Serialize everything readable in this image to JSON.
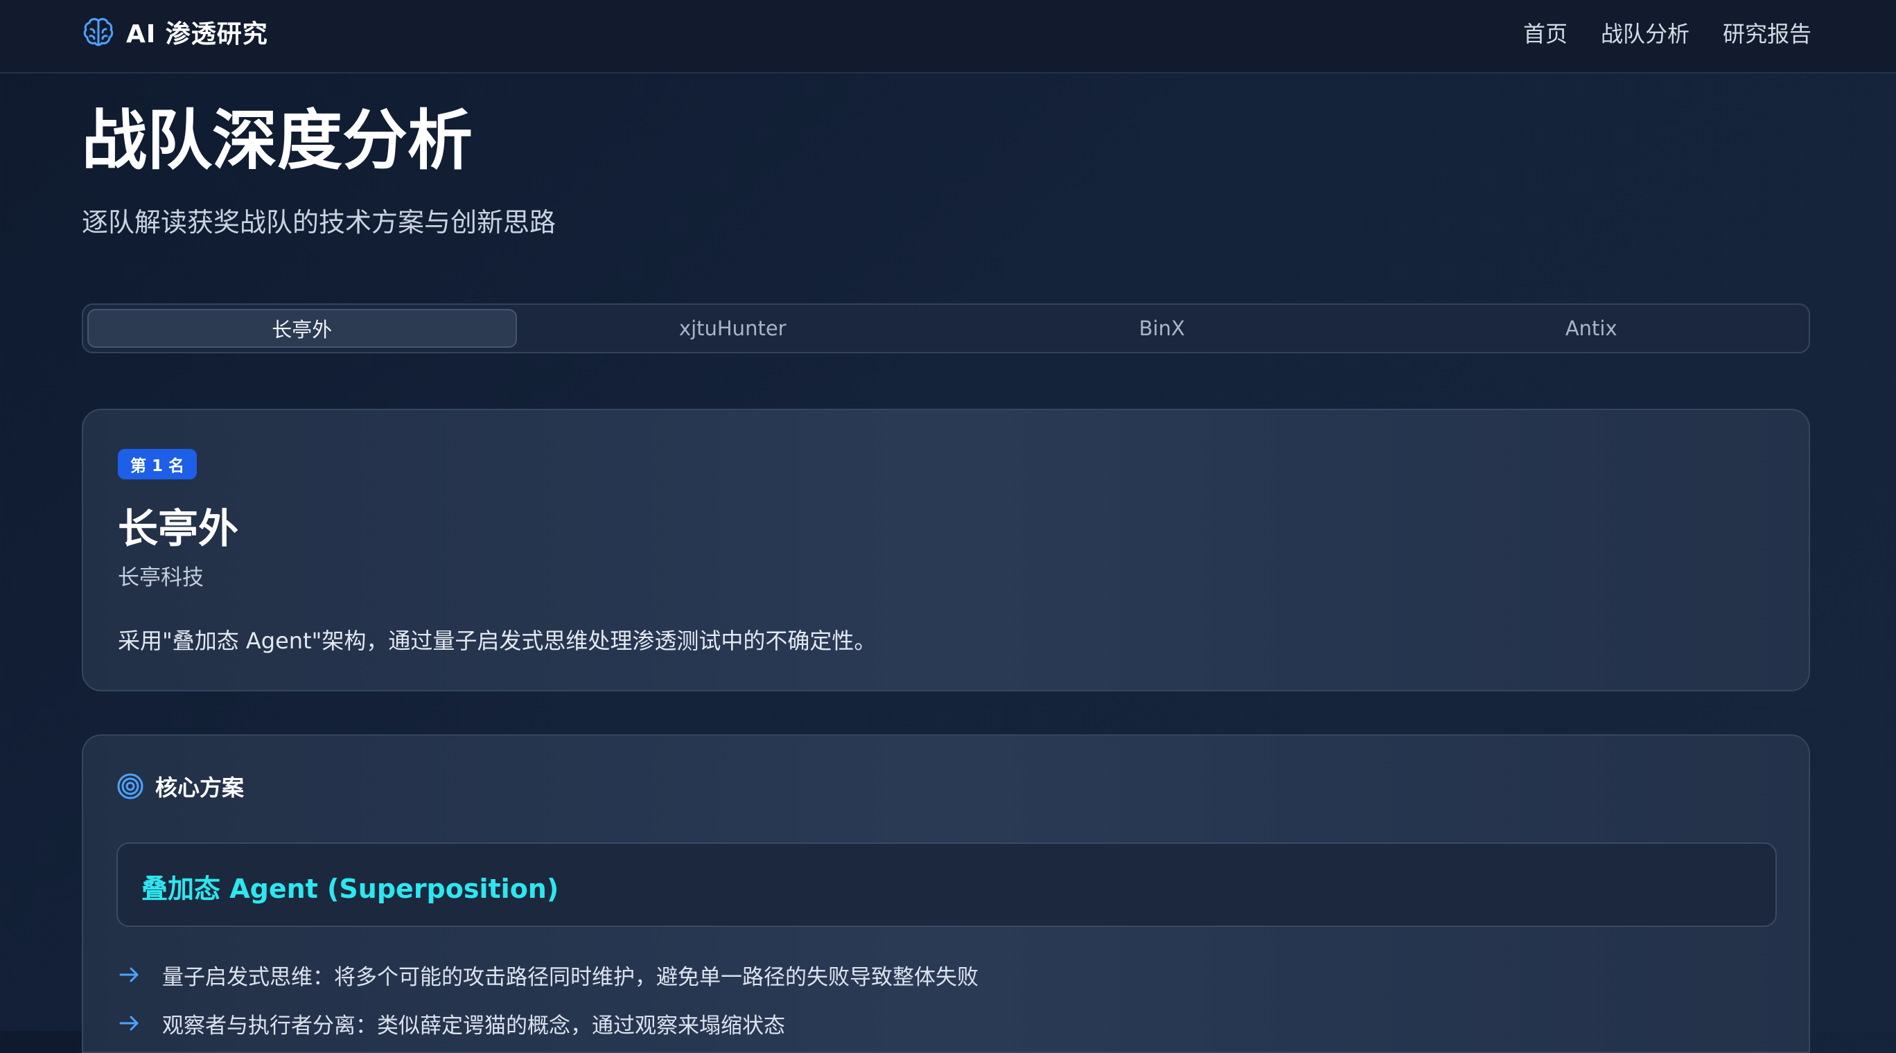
{
  "brand": {
    "name": "AI 渗透研究",
    "icon": "brain-icon"
  },
  "nav": {
    "links": [
      "首页",
      "战队分析",
      "研究报告"
    ]
  },
  "header": {
    "title": "战队深度分析",
    "subtitle": "逐队解读获奖战队的技术方案与创新思路"
  },
  "tabs": [
    {
      "label": "长亭外",
      "active": true
    },
    {
      "label": "xjtuHunter",
      "active": false
    },
    {
      "label": "BinX",
      "active": false
    },
    {
      "label": "Antix",
      "active": false
    }
  ],
  "team": {
    "rank_badge": "第 1 名",
    "name": "长亭外",
    "org": "长亭科技",
    "description": "采用\"叠加态 Agent\"架构，通过量子启发式思维处理渗透测试中的不确定性。"
  },
  "core": {
    "icon": "target-icon",
    "title": "核心方案",
    "approach_title": "叠加态 Agent (Superposition)",
    "bullets": [
      "量子启发式思维：将多个可能的攻击路径同时维护，避免单一路径的失败导致整体失败",
      "观察者与执行者分离：类似薛定谔猫的概念，通过观察来塌缩状态"
    ],
    "bullet_icon": "arrow-right-icon"
  },
  "colors": {
    "accent_cyan": "#2ee6f0",
    "badge_blue": "#1d5fe6",
    "icon_blue": "#4da3ff"
  }
}
